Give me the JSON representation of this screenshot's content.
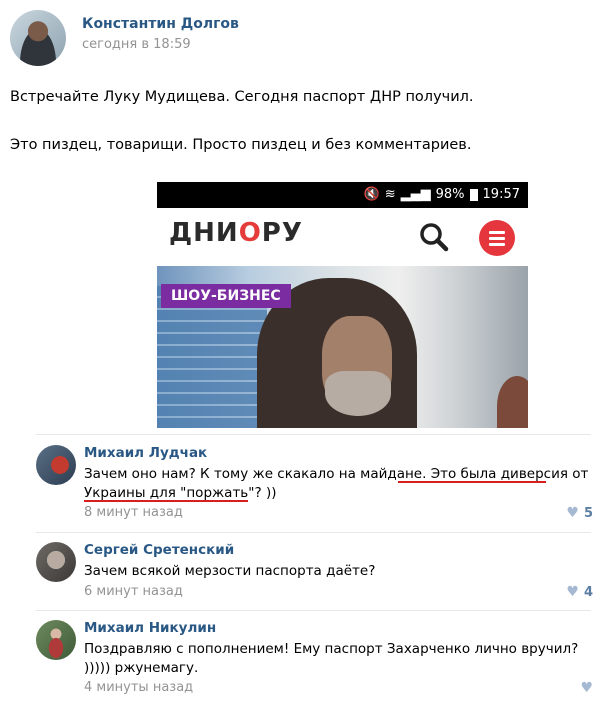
{
  "post": {
    "author": "Константин Долгов",
    "time": "сегодня в 18:59",
    "text_line1": "Встречайте Луку Мудищева. Сегодня паспорт ДНР получил.",
    "text_line2": "Это пиздец, товарищи. Просто пиздец и без комментариев."
  },
  "screenshot": {
    "status_battery": "98%",
    "status_time": "19:57",
    "logo_left": "ДНИ",
    "logo_ring": "О",
    "logo_right": "РУ",
    "tag": "ШОУ-БИЗНЕС"
  },
  "comments": [
    {
      "name": "Михаил Лудчак",
      "text_a": "Зачем оно нам? К тому же скакало на майдане. ",
      "text_u1": "Это была диверсия от",
      "text_u2": "Украины для \"поржать\"?",
      "text_b": " ))",
      "time": "8 минут назад",
      "likes": "5"
    },
    {
      "name": "Сергей Сретенский",
      "text": "Зачем всякой мерзости паспорта даёте?",
      "time": "6 минут назад",
      "likes": "4"
    },
    {
      "name": "Михаил Никулин",
      "text": "Поздравляю с пополнением! Ему паспорт Захарченко лично вручил? ))))) ржунемагу.",
      "time": "4 минуты назад",
      "likes": ""
    }
  ],
  "colors": {
    "link": "#2a5885",
    "muted": "#939393",
    "underline": "#d61f1f",
    "menu": "#e4363c",
    "tag": "#7a2ca0"
  }
}
